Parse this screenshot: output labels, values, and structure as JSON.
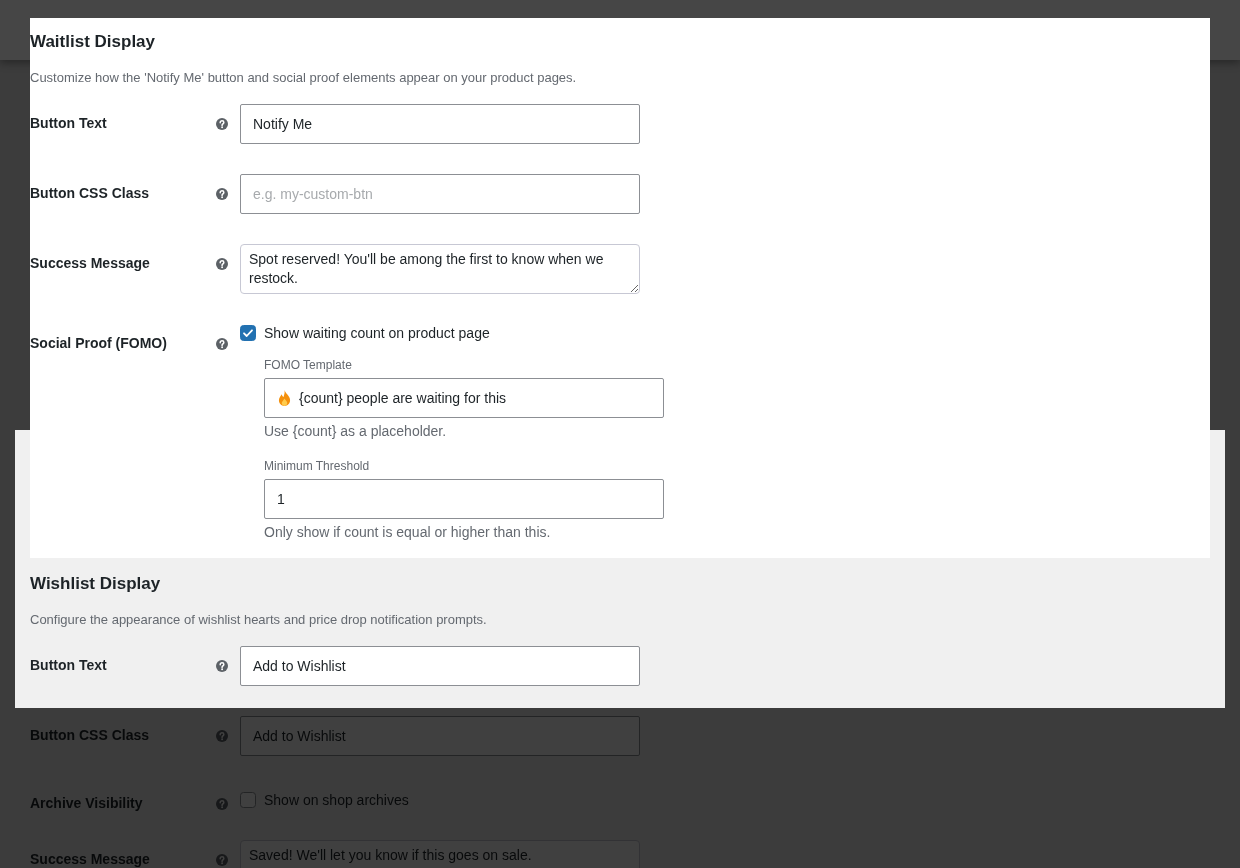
{
  "sections": [
    {
      "title": "Waitlist Display",
      "description": "Customize how the 'Notify Me' button and social proof elements appear on your product pages.",
      "focused": true,
      "fields": [
        {
          "label": "Button Text",
          "kind": "text",
          "dimmed": false,
          "value": "Notify Me"
        },
        {
          "label": "Button CSS Class",
          "kind": "text",
          "dimmed": false,
          "placeholder": "e.g. my-custom-btn"
        },
        {
          "label": "Success Message",
          "kind": "textarea",
          "dimmed": false,
          "value": "Spot reserved! You'll be among the first to know when we restock."
        },
        {
          "label": "Social Proof (FOMO)",
          "kind": "checkbox",
          "dimmed": false,
          "checkbox": {
            "label": "Show waiting count on product page",
            "checked": true
          },
          "subfields": [
            {
              "label": "FOMO Template",
              "leading_icon": true,
              "value": "{count} people are waiting for this",
              "hint": "Use {count} as a placeholder."
            },
            {
              "label": "Minimum Threshold",
              "value": "1",
              "hint": "Only show if count is equal or higher than this."
            }
          ]
        }
      ]
    },
    {
      "title": "Wishlist Display",
      "description": "Configure the appearance of wishlist hearts and price drop notification prompts.",
      "focused": false,
      "fields": [
        {
          "label": "Button Text",
          "kind": "text",
          "dimmed": false,
          "value": "Add to Wishlist"
        },
        {
          "label": "Button CSS Class",
          "kind": "text",
          "dimmed": true,
          "value": "Add to Wishlist"
        },
        {
          "label": "Archive Visibility",
          "kind": "checkbox",
          "dimmed": true,
          "checkbox": {
            "label": "Show on shop archives",
            "checked": false
          }
        },
        {
          "label": "Success Message",
          "kind": "textarea",
          "dimmed": true,
          "value": "Saved! We'll let you know if this goes on sale."
        }
      ]
    }
  ]
}
